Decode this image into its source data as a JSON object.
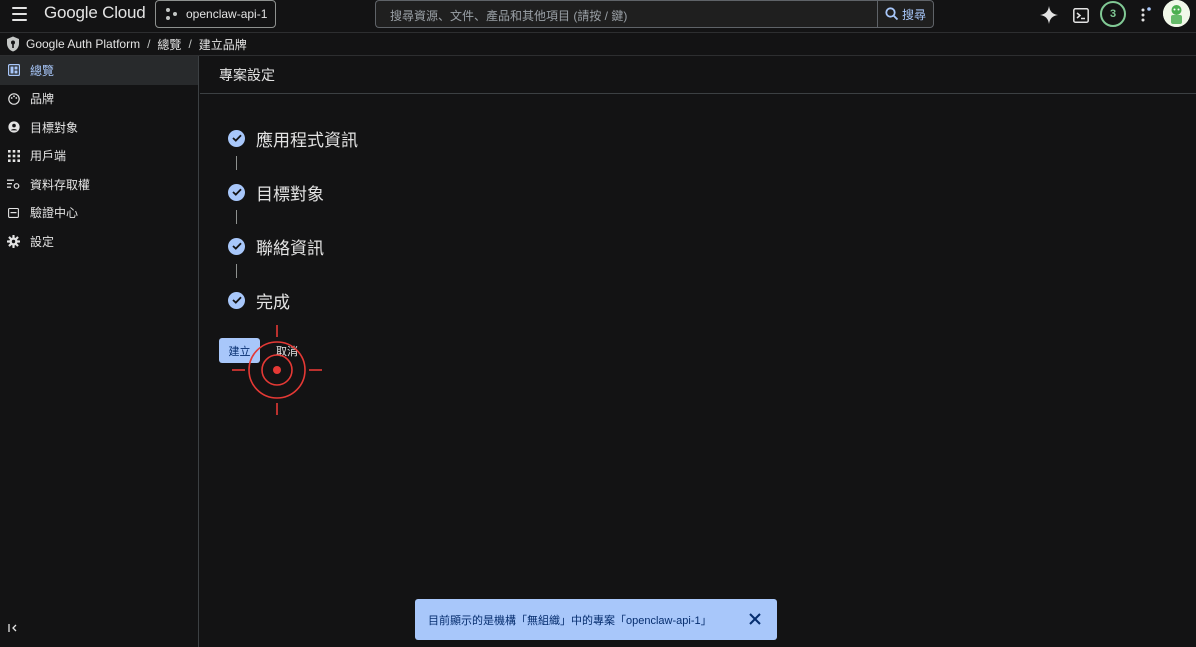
{
  "topbar": {
    "menu_icon": "hamburger-icon",
    "logo_text": "Google Cloud",
    "project": "openclaw-api-1",
    "search_placeholder": "搜尋資源、文件、產品和其他項目 (請按 / 鍵)",
    "search_button": "搜尋",
    "notifications_count": "3",
    "icons": [
      "gemini-sparkle-icon",
      "cloud-shell-icon",
      "more-vert-icon",
      "avatar"
    ]
  },
  "breadcrumb": {
    "product": "Google Auth Platform",
    "items": [
      "總覽",
      "建立品牌"
    ],
    "separator": "/"
  },
  "sidebar": {
    "items": [
      {
        "label": "總覽",
        "icon": "dashboard-icon",
        "active": true
      },
      {
        "label": "品牌",
        "icon": "palette-icon",
        "active": false
      },
      {
        "label": "目標對象",
        "icon": "person-icon",
        "active": false
      },
      {
        "label": "用戶端",
        "icon": "apps-grid-icon",
        "active": false
      },
      {
        "label": "資料存取權",
        "icon": "data-access-icon",
        "active": false
      },
      {
        "label": "驗證中心",
        "icon": "calendar-icon",
        "active": false
      },
      {
        "label": "設定",
        "icon": "gear-icon",
        "active": false
      }
    ],
    "collapse_icon": "collapse-sidebar-icon"
  },
  "main": {
    "title": "專案設定",
    "steps": [
      {
        "label": "應用程式資訊",
        "status": "done"
      },
      {
        "label": "目標對象",
        "status": "done"
      },
      {
        "label": "聯絡資訊",
        "status": "done"
      },
      {
        "label": "完成",
        "status": "done"
      }
    ],
    "create_button": "建立",
    "cancel_button": "取消"
  },
  "snackbar": {
    "message": "目前顯示的是機構「無組織」中的專案「openclaw-api-1」",
    "close_icon": "close-icon"
  },
  "colors": {
    "background": "#131314",
    "accent": "#a8c7fa",
    "text": "#e3e3e3",
    "target_marker": "#e53935"
  }
}
